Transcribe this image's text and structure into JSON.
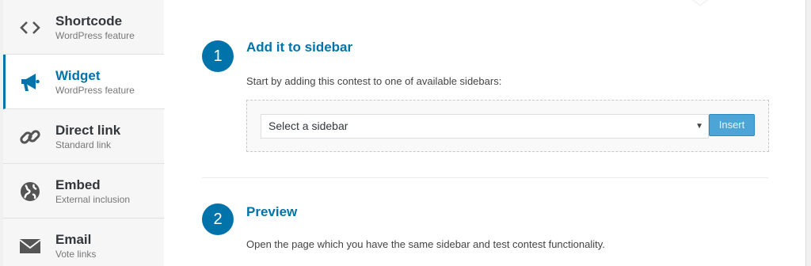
{
  "sidebar": {
    "items": [
      {
        "title": "Shortcode",
        "subtitle": "WordPress feature",
        "icon": "code-icon"
      },
      {
        "title": "Widget",
        "subtitle": "WordPress feature",
        "icon": "megaphone-icon"
      },
      {
        "title": "Direct link",
        "subtitle": "Standard link",
        "icon": "link-icon"
      },
      {
        "title": "Embed",
        "subtitle": "External inclusion",
        "icon": "globe-icon"
      },
      {
        "title": "Email",
        "subtitle": "Vote links",
        "icon": "envelope-icon"
      }
    ],
    "active_index": 1
  },
  "steps": [
    {
      "number": "1",
      "title": "Add it to sidebar",
      "text": "Start by adding this contest to one of available sidebars:"
    },
    {
      "number": "2",
      "title": "Preview",
      "text": "Open the page which you have the same sidebar and test contest functionality."
    }
  ],
  "sidebar_select": {
    "selected": "Select a sidebar"
  },
  "insert_button": {
    "label": "Insert"
  },
  "colors": {
    "accent": "#0073aa",
    "button": "#4ca5d6"
  }
}
